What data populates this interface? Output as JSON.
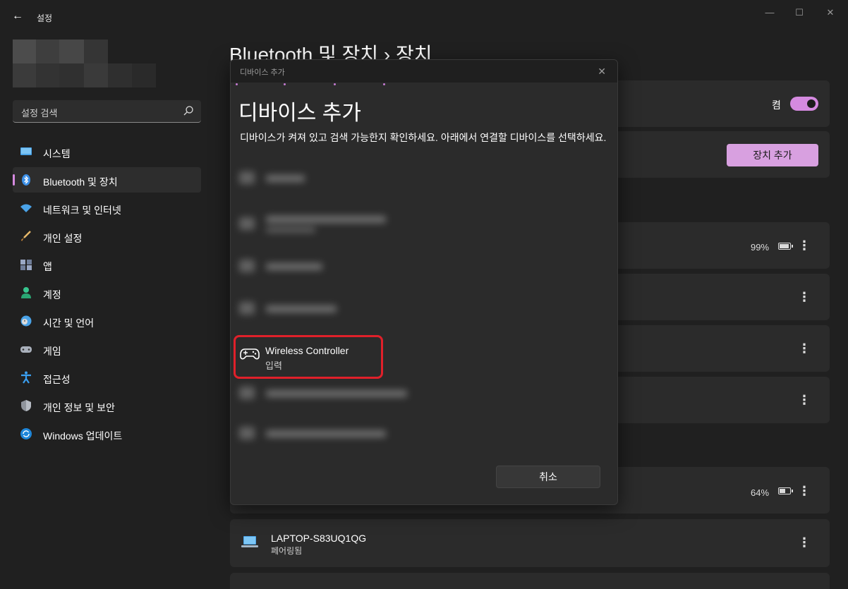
{
  "app": {
    "title": "설정"
  },
  "search": {
    "placeholder": "설정 검색"
  },
  "sidebar": {
    "items": [
      {
        "label": "시스템",
        "icon": "system-icon"
      },
      {
        "label": "Bluetooth 및 장치",
        "icon": "bluetooth-icon",
        "selected": true
      },
      {
        "label": "네트워크 및 인터넷",
        "icon": "wifi-icon"
      },
      {
        "label": "개인 설정",
        "icon": "brush-icon"
      },
      {
        "label": "앱",
        "icon": "apps-icon"
      },
      {
        "label": "계정",
        "icon": "account-icon"
      },
      {
        "label": "시간 및 언어",
        "icon": "time-language-icon"
      },
      {
        "label": "게임",
        "icon": "gaming-icon"
      },
      {
        "label": "접근성",
        "icon": "accessibility-icon"
      },
      {
        "label": "개인 정보 및 보안",
        "icon": "shield-icon"
      },
      {
        "label": "Windows 업데이트",
        "icon": "update-icon"
      }
    ]
  },
  "page": {
    "title": "Bluetooth 및 장치  ›  장치"
  },
  "bluetooth": {
    "toggle_label": "켬",
    "toggle_on": true
  },
  "add_device_button": "장치 추가",
  "devices": [
    {
      "battery_text": "99%",
      "battery_level": 0.99
    },
    {
      "battery_text": "64%",
      "battery_level": 0.64
    }
  ],
  "laptop": {
    "name": "LAPTOP-S83UQ1QG",
    "status": "페어링됨"
  },
  "dialog": {
    "caption": "디바이스 추가",
    "heading": "디바이스 추가",
    "description": "디바이스가 켜져 있고 검색 가능한지 확인하세요. 아래에서 연결할 디바이스를 선택하세요.",
    "highlighted_device": {
      "name": "Wireless Controller",
      "type": "입력",
      "icon": "gamepad-icon"
    },
    "cancel_label": "취소"
  },
  "colors": {
    "accent": "#d58ae0",
    "highlight": "#e0202a",
    "background": "#202020",
    "card": "#2b2b2b"
  }
}
